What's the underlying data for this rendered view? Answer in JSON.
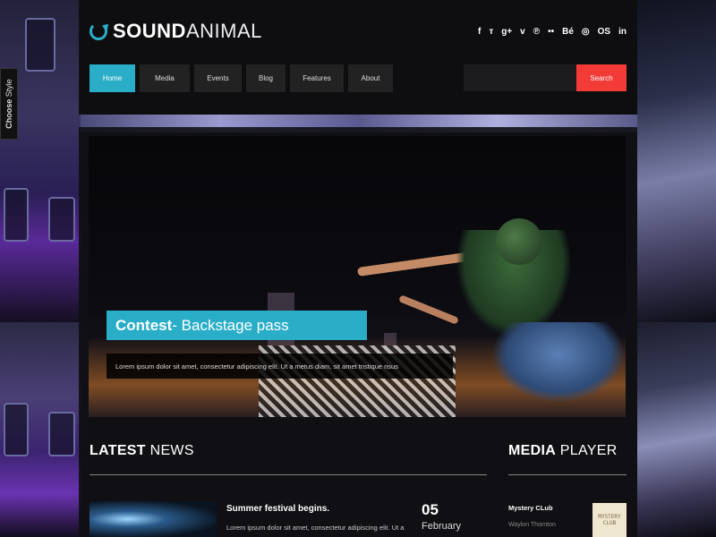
{
  "choose_style": {
    "bold": "Choose",
    "light": "Style"
  },
  "logo": {
    "bold": "SOUND",
    "light": "ANIMAL"
  },
  "social_icons": [
    {
      "name": "facebook-icon",
      "glyph": "f"
    },
    {
      "name": "twitter-icon",
      "glyph": "ᴛ"
    },
    {
      "name": "google-plus-icon",
      "glyph": "g+"
    },
    {
      "name": "vimeo-icon",
      "glyph": "v"
    },
    {
      "name": "pinterest-icon",
      "glyph": "℗"
    },
    {
      "name": "flickr-icon",
      "glyph": "••"
    },
    {
      "name": "behance-icon",
      "glyph": "Bé"
    },
    {
      "name": "tripadvisor-icon",
      "glyph": "◎"
    },
    {
      "name": "lastfm-icon",
      "glyph": "OS"
    },
    {
      "name": "linkedin-icon",
      "glyph": "in"
    }
  ],
  "nav": [
    {
      "label": "Home",
      "active": true
    },
    {
      "label": "Media",
      "active": false
    },
    {
      "label": "Events",
      "active": false
    },
    {
      "label": "Blog",
      "active": false
    },
    {
      "label": "Features",
      "active": false
    },
    {
      "label": "About",
      "active": false
    }
  ],
  "search": {
    "placeholder": "",
    "button_label": "Search"
  },
  "slide": {
    "title_bold": "Contest",
    "title_rest": " - Backstage pass",
    "caption": "Lorem ipsum dolor sit amet, consectetur adipiscing elit. Ut a metus diam, sit amet tristique risus"
  },
  "latest_news": {
    "title_bold": "LATEST",
    "title_light": " NEWS",
    "items": [
      {
        "headline": "Summer festival begins.",
        "excerpt": "Lorem ipsum dolor sit amet, consectetur adipiscing elit. Ut a",
        "day": "05",
        "month": "February"
      }
    ]
  },
  "media_player": {
    "title_bold": "MEDIA",
    "title_light": " PLAYER",
    "track": {
      "title": "Mystery CLub",
      "artist": "Waylon Thornton",
      "art_text": "MYSTERY CLUB"
    }
  },
  "colors": {
    "accent": "#2aaec8",
    "search_button": "#f23b36"
  }
}
